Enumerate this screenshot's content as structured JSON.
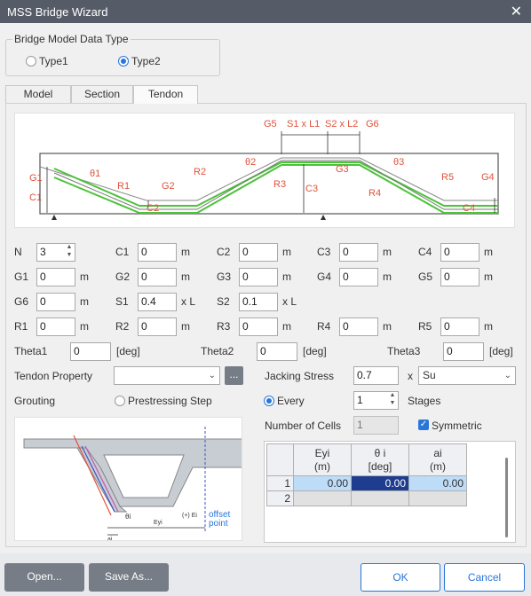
{
  "window": {
    "title": "MSS Bridge Wizard",
    "close": "✕"
  },
  "data_type": {
    "group_title": "Bridge Model Data Type",
    "option1": "Type1",
    "option2": "Type2",
    "selected": "Type2"
  },
  "tabs": [
    "Model",
    "Section",
    "Tendon"
  ],
  "active_tab": "Tendon",
  "figure": {
    "labels": {
      "G5": "G5",
      "G6": "G6",
      "S1L1": "S1 x L1",
      "S2L2": "S2 x L2",
      "G1": "G1",
      "C1": "C1",
      "theta1": "θ1",
      "R1": "R1",
      "G2": "G2",
      "R2": "R2",
      "C2": "C2",
      "theta2": "θ2",
      "R3": "R3",
      "C3": "C3",
      "G3": "G3",
      "R4": "R4",
      "theta3": "θ3",
      "R5": "R5",
      "G4": "G4",
      "C4": "C4"
    }
  },
  "fields": {
    "N": {
      "label": "N",
      "value": "3"
    },
    "C1": {
      "label": "C1",
      "value": "0",
      "unit": "m"
    },
    "C2": {
      "label": "C2",
      "value": "0",
      "unit": "m"
    },
    "C3": {
      "label": "C3",
      "value": "0",
      "unit": "m"
    },
    "C4": {
      "label": "C4",
      "value": "0",
      "unit": "m"
    },
    "G1": {
      "label": "G1",
      "value": "0",
      "unit": "m"
    },
    "G2": {
      "label": "G2",
      "value": "0",
      "unit": "m"
    },
    "G3": {
      "label": "G3",
      "value": "0",
      "unit": "m"
    },
    "G4": {
      "label": "G4",
      "value": "0",
      "unit": "m"
    },
    "G5": {
      "label": "G5",
      "value": "0",
      "unit": "m"
    },
    "G6": {
      "label": "G6",
      "value": "0",
      "unit": "m"
    },
    "S1": {
      "label": "S1",
      "value": "0.4",
      "unit": "x L"
    },
    "S2": {
      "label": "S2",
      "value": "0.1",
      "unit": "x L"
    },
    "R1": {
      "label": "R1",
      "value": "0",
      "unit": "m"
    },
    "R2": {
      "label": "R2",
      "value": "0",
      "unit": "m"
    },
    "R3": {
      "label": "R3",
      "value": "0",
      "unit": "m"
    },
    "R4": {
      "label": "R4",
      "value": "0",
      "unit": "m"
    },
    "R5": {
      "label": "R5",
      "value": "0",
      "unit": "m"
    },
    "Theta1": {
      "label": "Theta1",
      "value": "0",
      "unit": "[deg]"
    },
    "Theta2": {
      "label": "Theta2",
      "value": "0",
      "unit": "[deg]"
    },
    "Theta3": {
      "label": "Theta3",
      "value": "0",
      "unit": "[deg]"
    }
  },
  "tendon_property": {
    "label": "Tendon Property",
    "value": "",
    "browse": "..."
  },
  "jacking": {
    "label": "Jacking Stress",
    "value": "0.7",
    "x": "x",
    "unit_value": "Su"
  },
  "grouting": {
    "label": "Grouting",
    "opt_prestress": "Prestressing Step",
    "opt_every": "Every",
    "selected": "Every",
    "stages_value": "1",
    "stages_label": "Stages"
  },
  "cells": {
    "label": "Number of Cells",
    "value": "1",
    "symmetric_label": "Symmetric",
    "symmetric_checked": true
  },
  "section_fig": {
    "offset": "offset",
    "point": "point",
    "theta": "θi",
    "e": "Eyi",
    "plus": "(+) Ei",
    "a": "ai"
  },
  "grid": {
    "headers": [
      {
        "line1": "Eyi",
        "line2": "(m)"
      },
      {
        "line1": "θ i",
        "line2": "[deg]"
      },
      {
        "line1": "ai",
        "line2": "(m)"
      }
    ],
    "rows": [
      {
        "index": "1",
        "values": [
          "0.00",
          "0.00",
          "0.00"
        ]
      },
      {
        "index": "2",
        "values": [
          "",
          "",
          ""
        ]
      }
    ]
  },
  "buttons": {
    "open": "Open...",
    "save_as": "Save As...",
    "ok": "OK",
    "cancel": "Cancel"
  }
}
